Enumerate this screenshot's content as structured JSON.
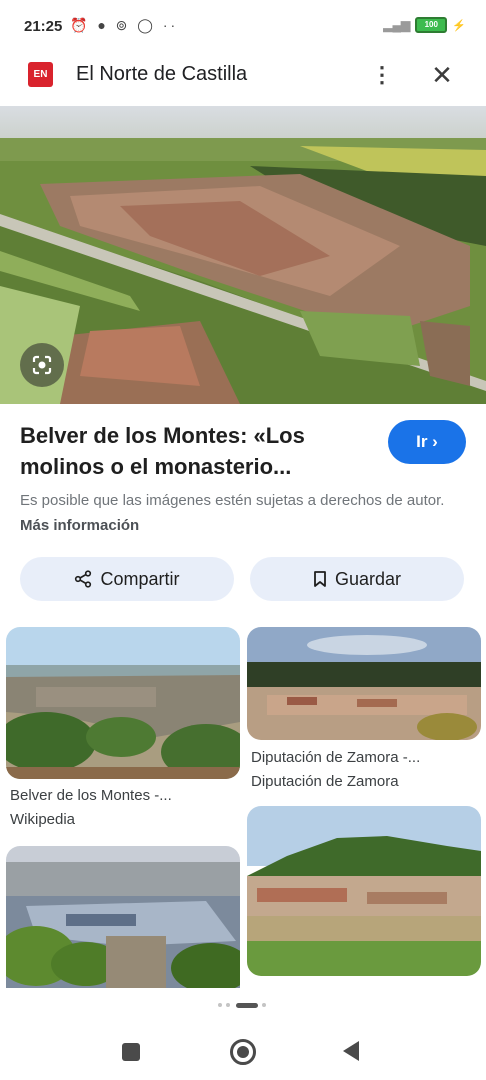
{
  "status": {
    "time": "21:25",
    "battery": "100"
  },
  "appbar": {
    "site_title": "El Norte de Castilla",
    "favicon_text": "EN"
  },
  "result": {
    "title": "Belver de los Montes: «Los molinos o el monasterio...",
    "go_label": "Ir ›",
    "notice": "Es posible que las imágenes estén sujetas a derechos de autor.",
    "more_info": "Más información"
  },
  "actions": {
    "share_label": "Compartir",
    "save_label": "Guardar"
  },
  "related": [
    {
      "title": "Belver de los Montes -...",
      "source": "Wikipedia"
    },
    {
      "title": "Diputación de Zamora -...",
      "source": "Diputación de Zamora"
    },
    {
      "title": "",
      "source": ""
    },
    {
      "title": "",
      "source": ""
    }
  ],
  "colors": {
    "accent": "#1a73e8",
    "pill_bg": "#e8eef9",
    "favicon": "#d9232d"
  }
}
